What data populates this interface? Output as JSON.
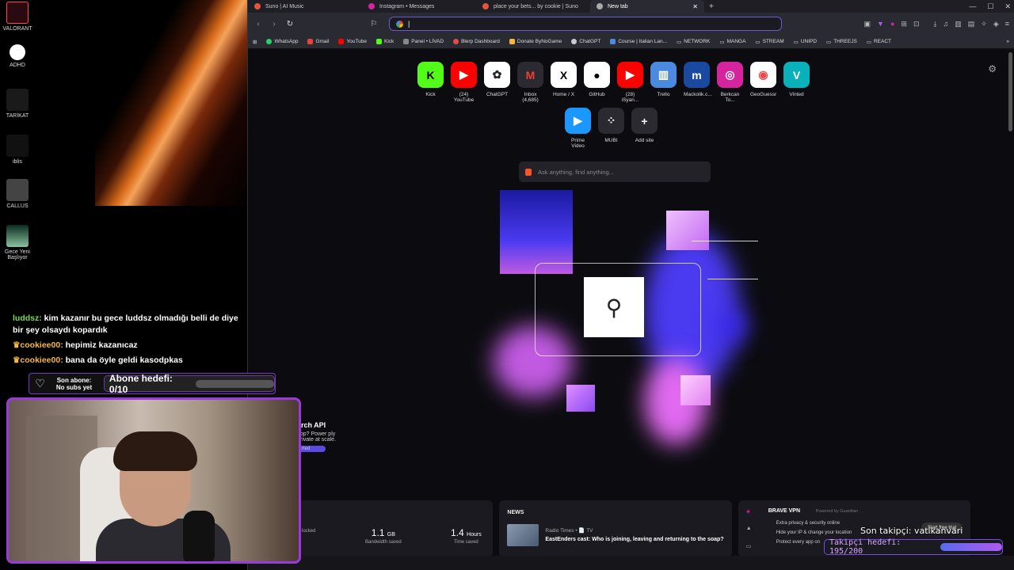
{
  "desktop": {
    "icons": [
      {
        "label": "VALORANT"
      },
      {
        "label": "ADHD"
      },
      {
        "label": "TARİKAT"
      },
      {
        "label": "iblis"
      },
      {
        "label": "CALLUS"
      },
      {
        "label": "Gece Yeni Başlıyor"
      }
    ]
  },
  "chat": {
    "messages": [
      {
        "user": "luddsz:",
        "text": "kim kazanır bu gece luddsz olmadığı belli de diye bir şey olsaydı kopardık"
      },
      {
        "user": "cookiee00:",
        "text": "hepimiz kazanıcaz"
      },
      {
        "user": "cookiee00:",
        "text": "bana da öyle geldi kasodpkas"
      }
    ]
  },
  "overlay": {
    "son_abone_label": "Son abone:",
    "son_abone_value": "No subs yet",
    "abone_hedefi": "Abone hedefi: 0/10",
    "son_takipci": "Son takipçi: vatikanvari",
    "takipci_hedefi": "Takipçi hedefi: 195/200",
    "takipci_progress": 0.975,
    "abone_progress": 0
  },
  "browser": {
    "tabs": [
      {
        "title": "Suno | AI Music",
        "color": "#e8543a"
      },
      {
        "title": "Instagram • Messages",
        "color": "#d6249f"
      },
      {
        "title": "place your bets... by cookie | Suno",
        "color": "#e8543a"
      },
      {
        "title": "New tab",
        "color": "#aaaaaa",
        "active": true
      }
    ],
    "new_tab_symbol": "+",
    "url_value": "",
    "bookmarks": [
      {
        "label": "WhatsApp",
        "color": "#25d366"
      },
      {
        "label": "Gmail",
        "color": "#ea4335"
      },
      {
        "label": "YouTube",
        "color": "#ff0000"
      },
      {
        "label": "Kick",
        "color": "#53fc18"
      },
      {
        "label": "Panel • LİVAD",
        "color": "#888888"
      },
      {
        "label": "Blerp Dashboard",
        "color": "#e84a4a"
      },
      {
        "label": "Donate ByNoGame",
        "color": "#f5b942"
      },
      {
        "label": "ChatGPT",
        "color": "#cccccc"
      },
      {
        "label": "Course | Italian Lan...",
        "color": "#4a8ae0"
      },
      {
        "label": "NETWORK",
        "folder": true
      },
      {
        "label": "MANGA",
        "folder": true
      },
      {
        "label": "STREAM",
        "folder": true
      },
      {
        "label": "UNIPD",
        "folder": true
      },
      {
        "label": "THREEJS",
        "folder": true
      },
      {
        "label": "REACT",
        "folder": true
      }
    ],
    "top_sites": [
      {
        "label": "Kick",
        "glyph": "K",
        "bg": "#53fc18",
        "fg": "#000000"
      },
      {
        "label": "(24) YouTube",
        "glyph": "▶",
        "bg": "#ff0000",
        "fg": "#ffffff"
      },
      {
        "label": "ChatGPT",
        "glyph": "✿",
        "bg": "#ffffff",
        "fg": "#222222"
      },
      {
        "label": "Inbox (4,685)",
        "glyph": "M",
        "bg": "#2a2a30",
        "fg": "#ea4335"
      },
      {
        "label": "Home / X",
        "glyph": "X",
        "bg": "#ffffff",
        "fg": "#000000"
      },
      {
        "label": "GitHub",
        "glyph": "●",
        "bg": "#ffffff",
        "fg": "#000000"
      },
      {
        "label": "(28) iSyan...",
        "glyph": "▶",
        "bg": "#ff0000",
        "fg": "#ffffff"
      },
      {
        "label": "Trello",
        "glyph": "▥",
        "bg": "#4a8ae0",
        "fg": "#ffffff"
      },
      {
        "label": "Mackolik.c...",
        "glyph": "m",
        "bg": "#1a4aa0",
        "fg": "#ffffff"
      },
      {
        "label": "Berkcan To...",
        "glyph": "◎",
        "bg": "#d6249f",
        "fg": "#ffffff"
      },
      {
        "label": "GeoGuessr",
        "glyph": "◉",
        "bg": "#ffffff",
        "fg": "#e84a4a"
      },
      {
        "label": "Vinted",
        "glyph": "V",
        "bg": "#09b1ba",
        "fg": "#ffffff"
      }
    ],
    "top_sites_row2": [
      {
        "label": "Prime Video",
        "glyph": "▶",
        "bg": "#1a98ff",
        "fg": "#ffffff"
      },
      {
        "label": "MUBI",
        "glyph": "⁘",
        "bg": "#2a2a30",
        "fg": "#ffffff"
      },
      {
        "label": "Add site",
        "glyph": "+",
        "bg": "#2a2a30",
        "fg": "#ffffff"
      }
    ],
    "search_placeholder": "Ask anything, find anything...",
    "api_title": "arch API",
    "api_text": "app? Power ply private at scale.",
    "api_btn": "rted",
    "stats": [
      {
        "value": "",
        "unit": "",
        "caption": "locked"
      },
      {
        "value": "1.1",
        "unit": "GB",
        "caption": "Bandwidth saved"
      },
      {
        "value": "1.4",
        "unit": "Hours",
        "caption": "Time saved"
      }
    ],
    "news": {
      "title": "NEWS",
      "source": "Radio Times • 📄 TV",
      "headline": "EastEnders cast: Who is joining, leaving and returning to the soap?"
    },
    "vpn": {
      "title": "BRAVE VPN",
      "powered": "Powered by Guardian",
      "lines": [
        "Extra privacy & security online",
        "Hide your IP & change your location",
        "Protect every app on"
      ],
      "button": "Start free trial"
    }
  }
}
